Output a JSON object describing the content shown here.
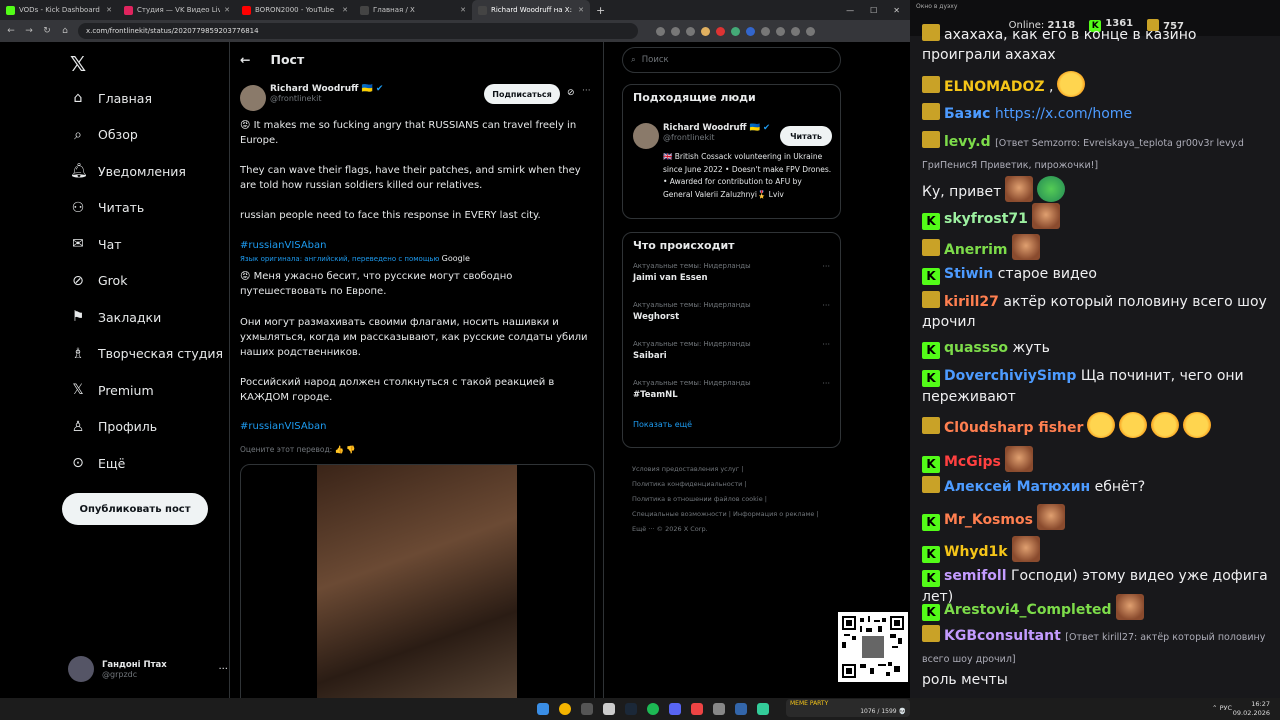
{
  "browser": {
    "tabs": [
      {
        "label": "VODs - Kick Dashboard",
        "color": "#53fc18"
      },
      {
        "label": "Студия — VK Видео Live",
        "color": "#e0245e"
      },
      {
        "label": "BORON2000 - YouTube",
        "color": "#ff0000"
      },
      {
        "label": "Главная / X",
        "color": "#444444"
      },
      {
        "label": "Richard Woodruff на X: «",
        "color": "#444444"
      }
    ],
    "new_tab": "+",
    "url": "x.com/frontlinekit/status/2020779859203776814"
  },
  "x": {
    "logo": "𝕏",
    "nav": [
      {
        "label": "Главная",
        "icon": "home-icon",
        "glyph": "⌂"
      },
      {
        "label": "Обзор",
        "icon": "search-icon",
        "glyph": "⌕"
      },
      {
        "label": "Уведомления",
        "icon": "bell-icon",
        "glyph": "♫"
      },
      {
        "label": "Читать",
        "icon": "follow-icon",
        "glyph": "♟"
      },
      {
        "label": "Чат",
        "icon": "mail-icon",
        "glyph": "✉"
      },
      {
        "label": "Grok",
        "icon": "grok-icon",
        "glyph": "⊘"
      },
      {
        "label": "Закладки",
        "icon": "bookmark-icon",
        "glyph": "⎘"
      },
      {
        "label": "Творческая студия",
        "icon": "studio-icon",
        "glyph": "♙"
      },
      {
        "label": "Premium",
        "icon": "premium-icon",
        "glyph": "𝕏"
      },
      {
        "label": "Профиль",
        "icon": "profile-icon",
        "glyph": "♙"
      },
      {
        "label": "Ещё",
        "icon": "more-icon",
        "glyph": "⊙"
      }
    ],
    "post_button": "Опубликовать пост",
    "account": {
      "name": "Гандоні Птах",
      "handle": "@grpzdc"
    },
    "post_header": "Пост",
    "back": "←",
    "tweet": {
      "author": "Richard Woodruff 🇺🇦",
      "handle": "@frontlinekit",
      "subscribe": "Подписаться",
      "p1": "😡 It makes me so fucking angry that RUSSIANS can travel freely in Europe.",
      "p2": "They can wave their flags, have their patches, and smirk when they are told how russian soldiers killed our relatives.",
      "p3": "russian people need to face this response in EVERY last city.",
      "hashtag": "#russianVISAban",
      "translate_note": "Язык оригинала: английский, переведено с помощью",
      "translate_brand": "Google",
      "t1": "😡 Меня ужасно бесит, что русские могут свободно путешествовать по Европе.",
      "t2": "Они могут размахивать своими флагами, носить нашивки и ухмыляться, когда им рассказывают, как русские солдаты убили наших родственников.",
      "t3": "Российский народ должен столкнуться с такой реакцией в КАЖДОМ городе.",
      "hashtag2": "#russianVISAban",
      "rate": "Оцените этот перевод: 👍 👎"
    },
    "search_placeholder": "Поиск",
    "people": {
      "title": "Подходящие люди",
      "name": "Richard Woodruff 🇺🇦",
      "handle": "@frontlinekit",
      "follow": "Читать",
      "bio": "🇬🇧 British Cossack volunteering in Ukraine since June 2022 • Doesn't make FPV Drones. • Awarded for contribution to AFU by General Valerii Zaluzhnyi🎖️ Lviv"
    },
    "trends": {
      "title": "Что происходит",
      "items": [
        {
          "cat": "Актуальные темы: Нидерланды",
          "name": "Jaimi van Essen"
        },
        {
          "cat": "Актуальные темы: Нидерланды",
          "name": "Weghorst"
        },
        {
          "cat": "Актуальные темы: Нидерланды",
          "name": "Saibari"
        },
        {
          "cat": "Актуальные темы: Нидерланды",
          "name": "#TeamNL"
        }
      ],
      "more": "Показать ещё"
    },
    "footer": [
      "Условия предоставления услуг |",
      "Политика конфиденциальности |",
      "Политика в отношении файлов cookie |",
      "Специальные возможности |  Информация о рекламе |",
      "Ещё ···   © 2026 X Corp."
    ]
  },
  "chat": {
    "window_title": "Окно в дуэху",
    "online_label": "Online:",
    "online": "2118",
    "kick_count": "1361",
    "crown_count": "757",
    "messages": [
      {
        "user": "",
        "text": "ахахаха, как его в конце в казино проиграли ахахах",
        "badge": "crown"
      },
      {
        "user": "ELNOMADOZ",
        "text": ",",
        "badge": "crown",
        "color": "#f5c518"
      },
      {
        "user": "Базис",
        "text": "https://x.com/home",
        "badge": "crown",
        "color": "#4d9bff"
      },
      {
        "user": "levy.d",
        "text": "Ку, привет",
        "badge": "crown",
        "color": "#7ddc4a",
        "reply": "[Ответ Semzorro: Evreiskaya_teplota gr00v3r levy.d ГриПенисЯ Приветик, пирожочки!]"
      },
      {
        "user": "skyfrost71",
        "text": "",
        "badge": "kick",
        "color": "#9cf0a0"
      },
      {
        "user": "Anerrim",
        "text": "",
        "badge": "crown",
        "color": "#7ddc4a"
      },
      {
        "user": "Stiwin",
        "text": "старое видео",
        "badge": "kick",
        "color": "#4d9bff"
      },
      {
        "user": "kirill27",
        "text": "актёр который половину всего шоу дрочил",
        "badge": "crown",
        "color": "#ff7f50"
      },
      {
        "user": "quassso",
        "text": "жуть",
        "badge": "kick",
        "color": "#7ddc4a"
      },
      {
        "user": "DoverchiviySimp",
        "text": "Ща починит, чего они переживают",
        "badge": "kick",
        "color": "#4d9bff"
      },
      {
        "user": "Cl0udsharp fisher",
        "text": "",
        "badge": "crown",
        "color": "#ff7f50"
      },
      {
        "user": "McGips",
        "text": "",
        "badge": "kick",
        "color": "#ff4040"
      },
      {
        "user": "Алексей Матюхин",
        "text": "ебнёт?",
        "badge": "crown",
        "color": "#4d9bff"
      },
      {
        "user": "Mr_Kosmos",
        "text": "",
        "badge": "kick",
        "color": "#ff7f50"
      },
      {
        "user": "Whyd1k",
        "text": "",
        "badge": "kick",
        "color": "#f5c518"
      },
      {
        "user": "semifoll",
        "text": "Господи) этому видео уже дофига лет)",
        "badge": "kick",
        "color": "#c39bff"
      },
      {
        "user": "Arestovi4_Completed",
        "text": "",
        "badge": "kick",
        "color": "#7ddc4a"
      },
      {
        "user": "KGBconsultant",
        "text": "роль мечты",
        "badge": "crown",
        "color": "#c39bff",
        "reply": "[Ответ kirill27: актёр который половину всего шоу дрочил]"
      }
    ]
  },
  "taskbar": {
    "lang": "РУС",
    "time": "16:27",
    "date": "09.02.2026",
    "meme": "MEME PARTY",
    "meme_count": "1076 / 1599 💀"
  }
}
